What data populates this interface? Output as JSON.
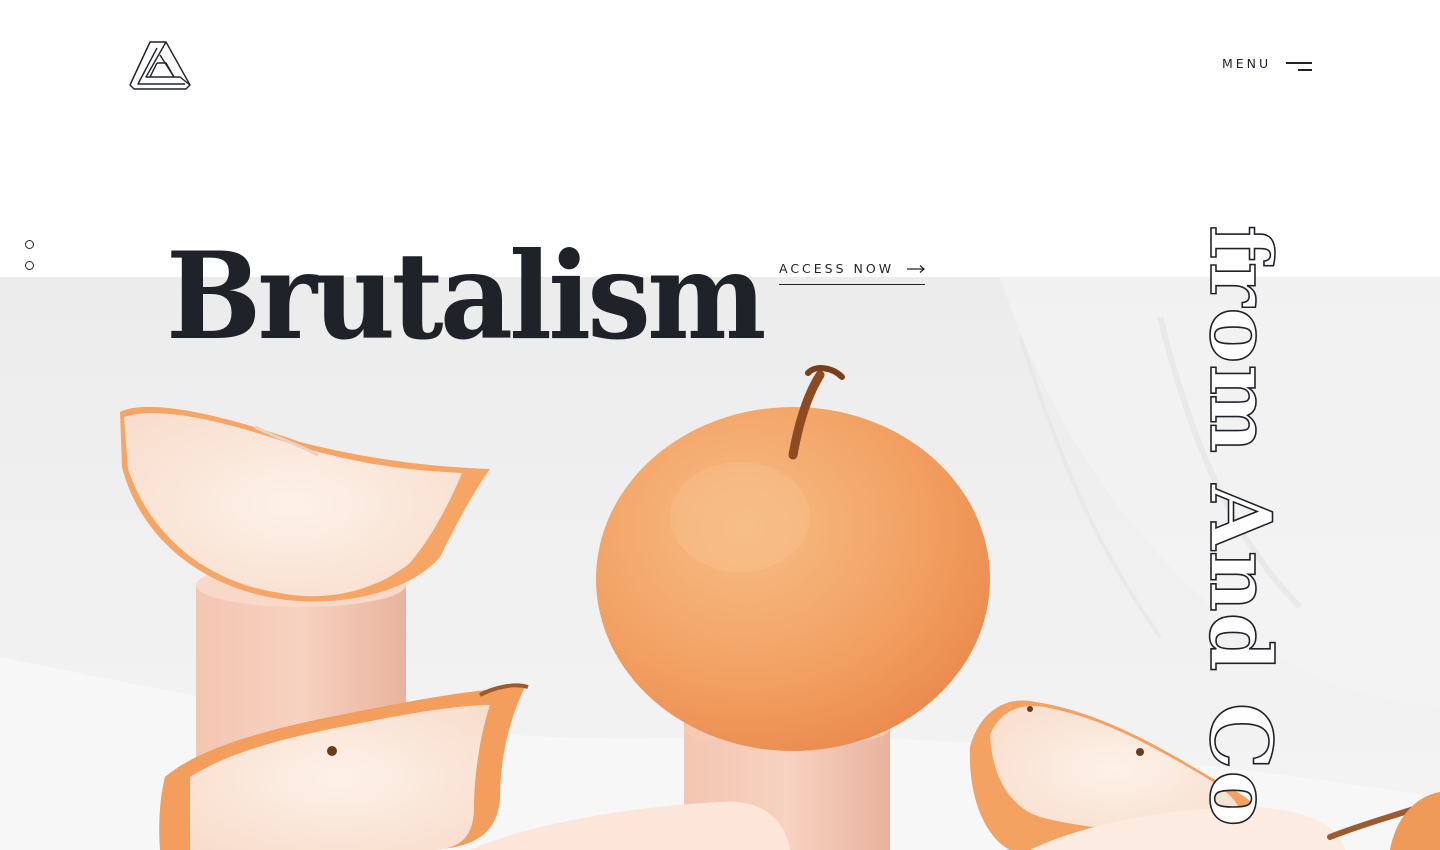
{
  "header": {
    "logo_icon": "impossible-triangle-logo",
    "menu_label": "MENU",
    "menu_icon": "hamburger-icon"
  },
  "slider": {
    "total": 4,
    "active_index": 3
  },
  "hero": {
    "headline": "Brutalism",
    "cta_label": "ACCESS NOW",
    "cta_icon": "arrow-right-icon",
    "vertical_text": "from And Co"
  },
  "colors": {
    "text": "#1f2329",
    "background": "#ffffff",
    "photo_backdrop": "#efefef",
    "pear_orange": "#f2a463",
    "pear_flesh": "#fbe3d3",
    "wood_block": "#f0c1ad"
  }
}
